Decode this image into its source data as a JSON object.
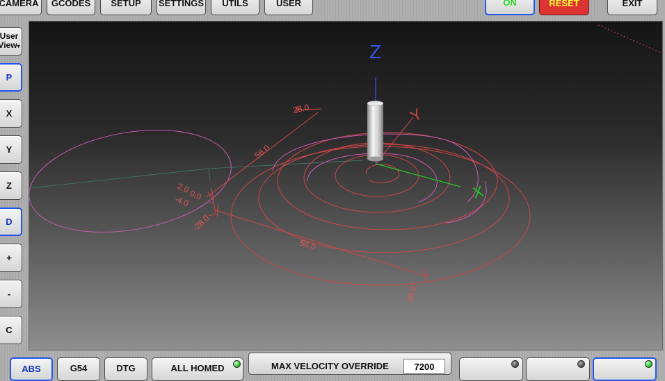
{
  "top_tabs": [
    "CAMERA",
    "GCODES",
    "SETUP",
    "SETTINGS",
    "UTILS",
    "USER"
  ],
  "machine": {
    "on_label": "ON",
    "reset_label": "RESET",
    "exit_label": "EXIT"
  },
  "side": {
    "user_view": {
      "line1": "User",
      "line2": "View",
      "arrow": "▾"
    },
    "buttons": [
      "P",
      "X",
      "Y",
      "Z",
      "D",
      "+",
      "-",
      "C"
    ]
  },
  "bottom": {
    "abs_label": "ABS",
    "g54_label": "G54",
    "dtg_label": "DTG",
    "homed_label": "ALL HOMED",
    "velocity_label": "MAX VELOCITY OVERRIDE",
    "velocity_value": "7200"
  },
  "viewport": {
    "axis": {
      "x": "X",
      "y": "Y",
      "z": "Z"
    },
    "dims": {
      "y_extent": "56.0",
      "y_max": "28.0",
      "z_top": "2.0",
      "z_mid": "0.0",
      "z_bot": "-4.0",
      "x_min": "-28.0",
      "x_extent": "56.0",
      "x_max": "28.0"
    }
  },
  "colors": {
    "on_text": "#22dd22",
    "reset_bg": "#dd3333",
    "reset_text": "#ffff33",
    "path_pink": "#cc5bb5",
    "path_red": "#d24646",
    "select_border": "#2255ee"
  }
}
